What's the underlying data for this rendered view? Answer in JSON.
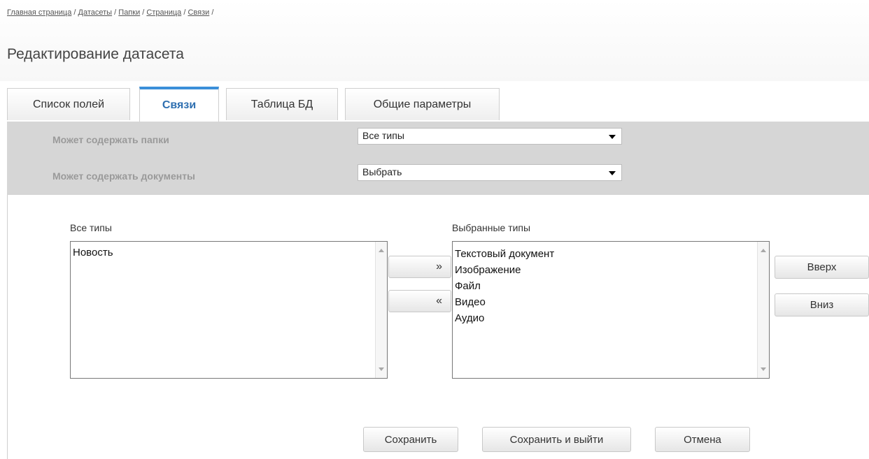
{
  "breadcrumb": {
    "items": [
      "Главная страница",
      "Датасеты",
      "Папки",
      "Страница",
      "Связи"
    ],
    "separator": "/"
  },
  "page": {
    "title": "Редактирование датасета"
  },
  "tabs": [
    {
      "label": "Список полей",
      "active": false
    },
    {
      "label": "Связи",
      "active": true
    },
    {
      "label": "Таблица БД",
      "active": false
    },
    {
      "label": "Общие параметры",
      "active": false
    }
  ],
  "settings": {
    "folders": {
      "label": "Может содержать папки",
      "value": "Все типы"
    },
    "documents": {
      "label": "Может содержать документы",
      "value": "Выбрать"
    }
  },
  "lists": {
    "all": {
      "label": "Все типы",
      "items": [
        "Новость"
      ]
    },
    "selected": {
      "label": "Выбранные типы",
      "items": [
        "Текстовый документ",
        "Изображение",
        "Файл",
        "Видео",
        "Аудио"
      ]
    }
  },
  "buttons": {
    "add": "»",
    "remove": "«",
    "up": "Вверх",
    "down": "Вниз",
    "save": "Сохранить",
    "save_exit": "Сохранить и выйти",
    "cancel": "Отмена"
  },
  "colors": {
    "active_tab_accent": "#3b8fd9",
    "active_tab_text": "#2e6fb0",
    "settings_panel_bg": "#d6d6d6"
  }
}
